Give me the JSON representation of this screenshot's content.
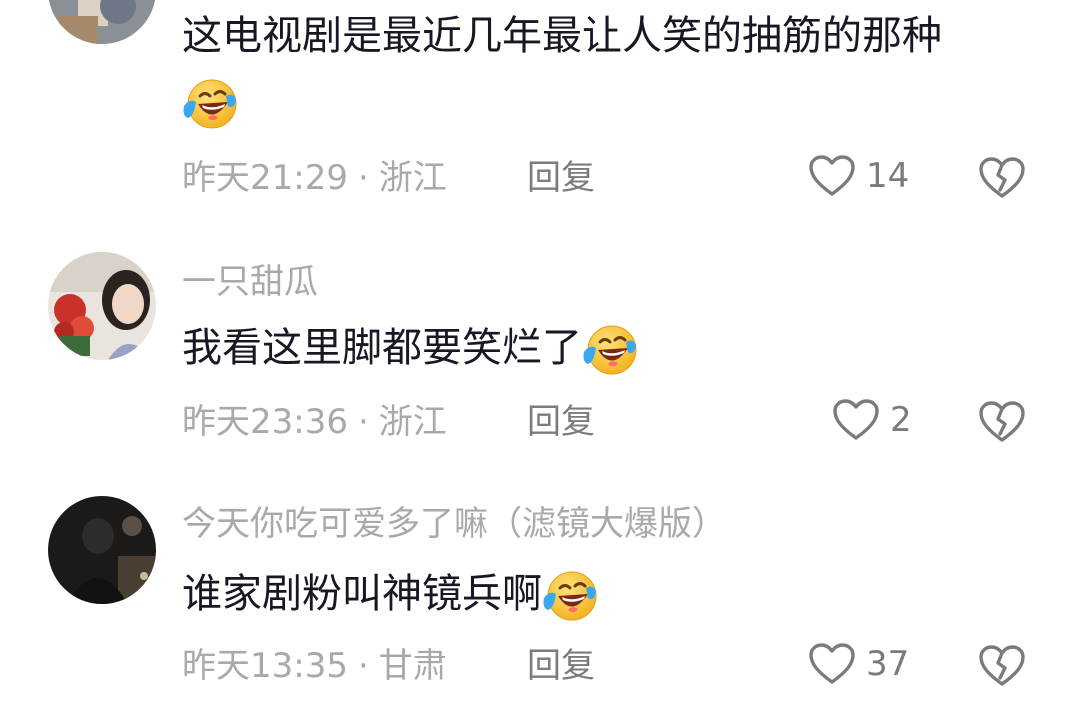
{
  "comments": [
    {
      "username": "",
      "text": "这电视剧是最近几年最让人笑的抽筋的那种",
      "emoji": "laughing-crying-emoji",
      "time": "昨天21:29",
      "location": "浙江",
      "reply_label": "回复",
      "likes": "14"
    },
    {
      "username": "一只甜瓜",
      "text": "我看这里脚都要笑烂了",
      "emoji": "laughing-crying-emoji",
      "time": "昨天23:36",
      "location": "浙江",
      "reply_label": "回复",
      "likes": "2"
    },
    {
      "username": "今天你吃可爱多了嘛（滤镜大爆版）",
      "text": "谁家剧粉叫神镜兵啊",
      "emoji": "laughing-crying-emoji",
      "time": "昨天13:35",
      "location": "甘肃",
      "reply_label": "回复",
      "likes": "37"
    }
  ],
  "separator": "·",
  "colors": {
    "meta_gray": "#a8a9ad",
    "action_gray": "#7a7b80",
    "text": "#161823",
    "emoji_yellow": "#f7c33b",
    "emoji_tear": "#3ba7f0"
  }
}
